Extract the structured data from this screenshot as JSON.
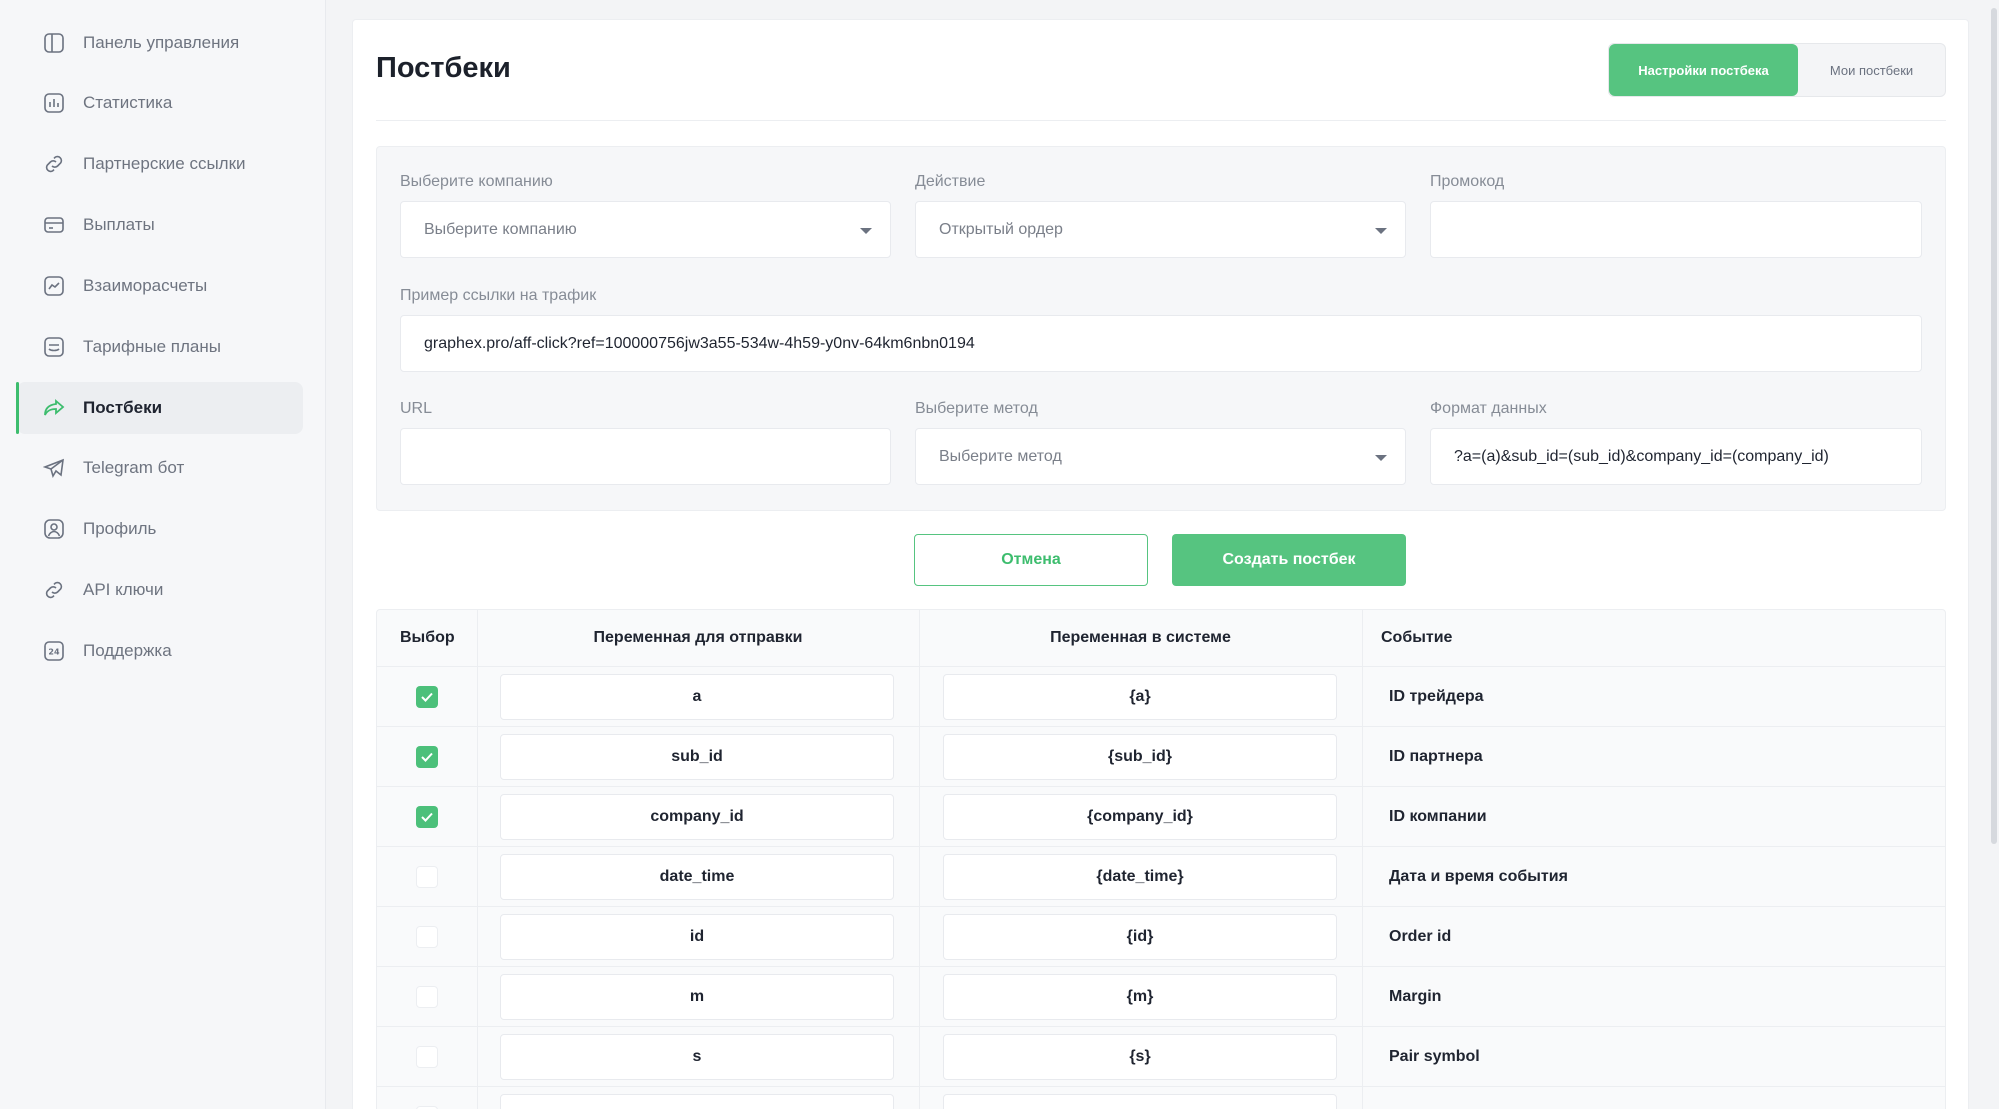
{
  "sidebar": {
    "items": [
      {
        "label": "Панель управления",
        "icon": "dashboard-icon"
      },
      {
        "label": "Статистика",
        "icon": "chart-icon"
      },
      {
        "label": "Партнерские ссылки",
        "icon": "link-icon"
      },
      {
        "label": "Выплаты",
        "icon": "card-icon"
      },
      {
        "label": "Взаиморасчеты",
        "icon": "trend-icon"
      },
      {
        "label": "Тарифные планы",
        "icon": "plan-icon"
      },
      {
        "label": "Постбеки",
        "icon": "share-arrow-icon"
      },
      {
        "label": "Telegram бот",
        "icon": "telegram-icon"
      },
      {
        "label": "Профиль",
        "icon": "user-icon"
      },
      {
        "label": "API ключи",
        "icon": "key-link-icon"
      },
      {
        "label": "Поддержка",
        "icon": "support-24-icon"
      }
    ],
    "active_index": 6
  },
  "header": {
    "title": "Постбеки",
    "tabs": [
      {
        "label": "Настройки постбека"
      },
      {
        "label": "Мои постбеки"
      }
    ]
  },
  "form": {
    "company": {
      "label": "Выберите компанию",
      "value": "Выберите компанию"
    },
    "action": {
      "label": "Действие",
      "value": "Открытый ордер"
    },
    "promo": {
      "label": "Промокод",
      "value": ""
    },
    "traffic_link": {
      "label": "Пример ссылки на трафик",
      "value": "graphex.pro/aff-click?ref=100000756jw3a55-534w-4h59-y0nv-64km6nbn0194"
    },
    "url": {
      "label": "URL",
      "value": ""
    },
    "method": {
      "label": "Выберите метод",
      "value": "Выберите метод"
    },
    "data_format": {
      "label": "Формат данных",
      "value": "?a=(a)&sub_id=(sub_id)&company_id=(company_id)"
    }
  },
  "buttons": {
    "cancel": "Отмена",
    "create": "Создать постбек"
  },
  "table": {
    "headers": [
      "Выбор",
      "Переменная для отправки",
      "Переменная в системе",
      "Событие"
    ],
    "rows": [
      {
        "checked": true,
        "send": "a",
        "system": "{a}",
        "event": "ID трейдера"
      },
      {
        "checked": true,
        "send": "sub_id",
        "system": "{sub_id}",
        "event": "ID партнера"
      },
      {
        "checked": true,
        "send": "company_id",
        "system": "{company_id}",
        "event": "ID компании"
      },
      {
        "checked": false,
        "send": "date_time",
        "system": "{date_time}",
        "event": "Дата и время события"
      },
      {
        "checked": false,
        "send": "id",
        "system": "{id}",
        "event": "Order id"
      },
      {
        "checked": false,
        "send": "m",
        "system": "{m}",
        "event": "Margin"
      },
      {
        "checked": false,
        "send": "s",
        "system": "{s}",
        "event": "Pair symbol"
      },
      {
        "checked": false,
        "send": "",
        "system": "",
        "event": ""
      }
    ]
  },
  "colors": {
    "accent": "#56c480",
    "accent_dark": "#3dbd6e",
    "background": "#f3f4f6"
  }
}
